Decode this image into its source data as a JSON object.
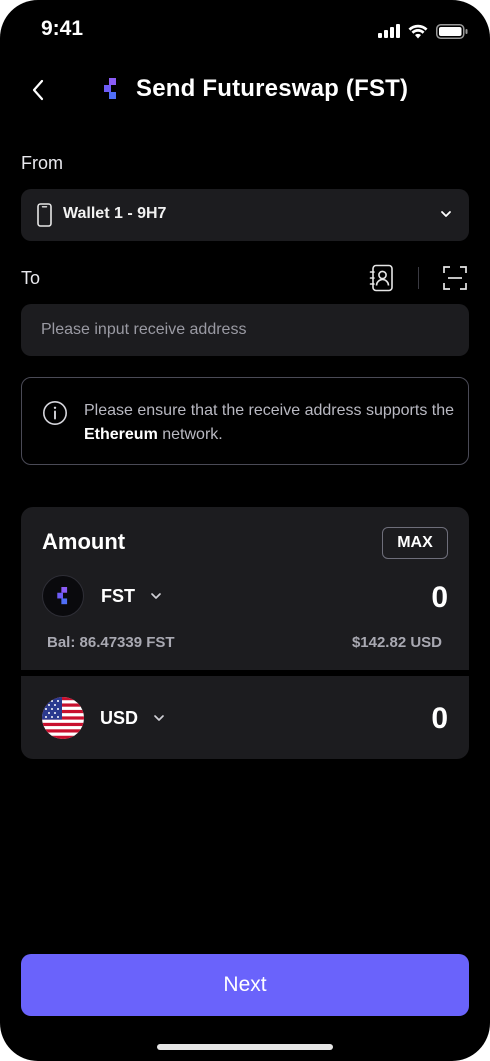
{
  "status_bar": {
    "time": "9:41"
  },
  "header": {
    "title": "Send Futureswap (FST)",
    "token_icon": "futureswap-logo"
  },
  "from": {
    "label": "From",
    "wallet_name": "Wallet 1 - 9H7"
  },
  "to": {
    "label": "To",
    "address_value": "",
    "address_placeholder": "Please input receive address"
  },
  "notice": {
    "text_before": "Please ensure that the receive address supports the ",
    "network": "Ethereum",
    "text_after": " network."
  },
  "amount": {
    "title": "Amount",
    "max_label": "MAX",
    "token_symbol": "FST",
    "token_value": "0",
    "balance": "Bal: 86.47339 FST",
    "balance_usd": "$142.82 USD",
    "fiat_symbol": "USD",
    "fiat_value": "0"
  },
  "footer": {
    "next_label": "Next"
  },
  "colors": {
    "accent": "#6a63fb",
    "card_bg": "#1c1c1f",
    "background": "#000000",
    "logo_purple": "#8b5cf6",
    "logo_blue": "#4f6ef7"
  }
}
